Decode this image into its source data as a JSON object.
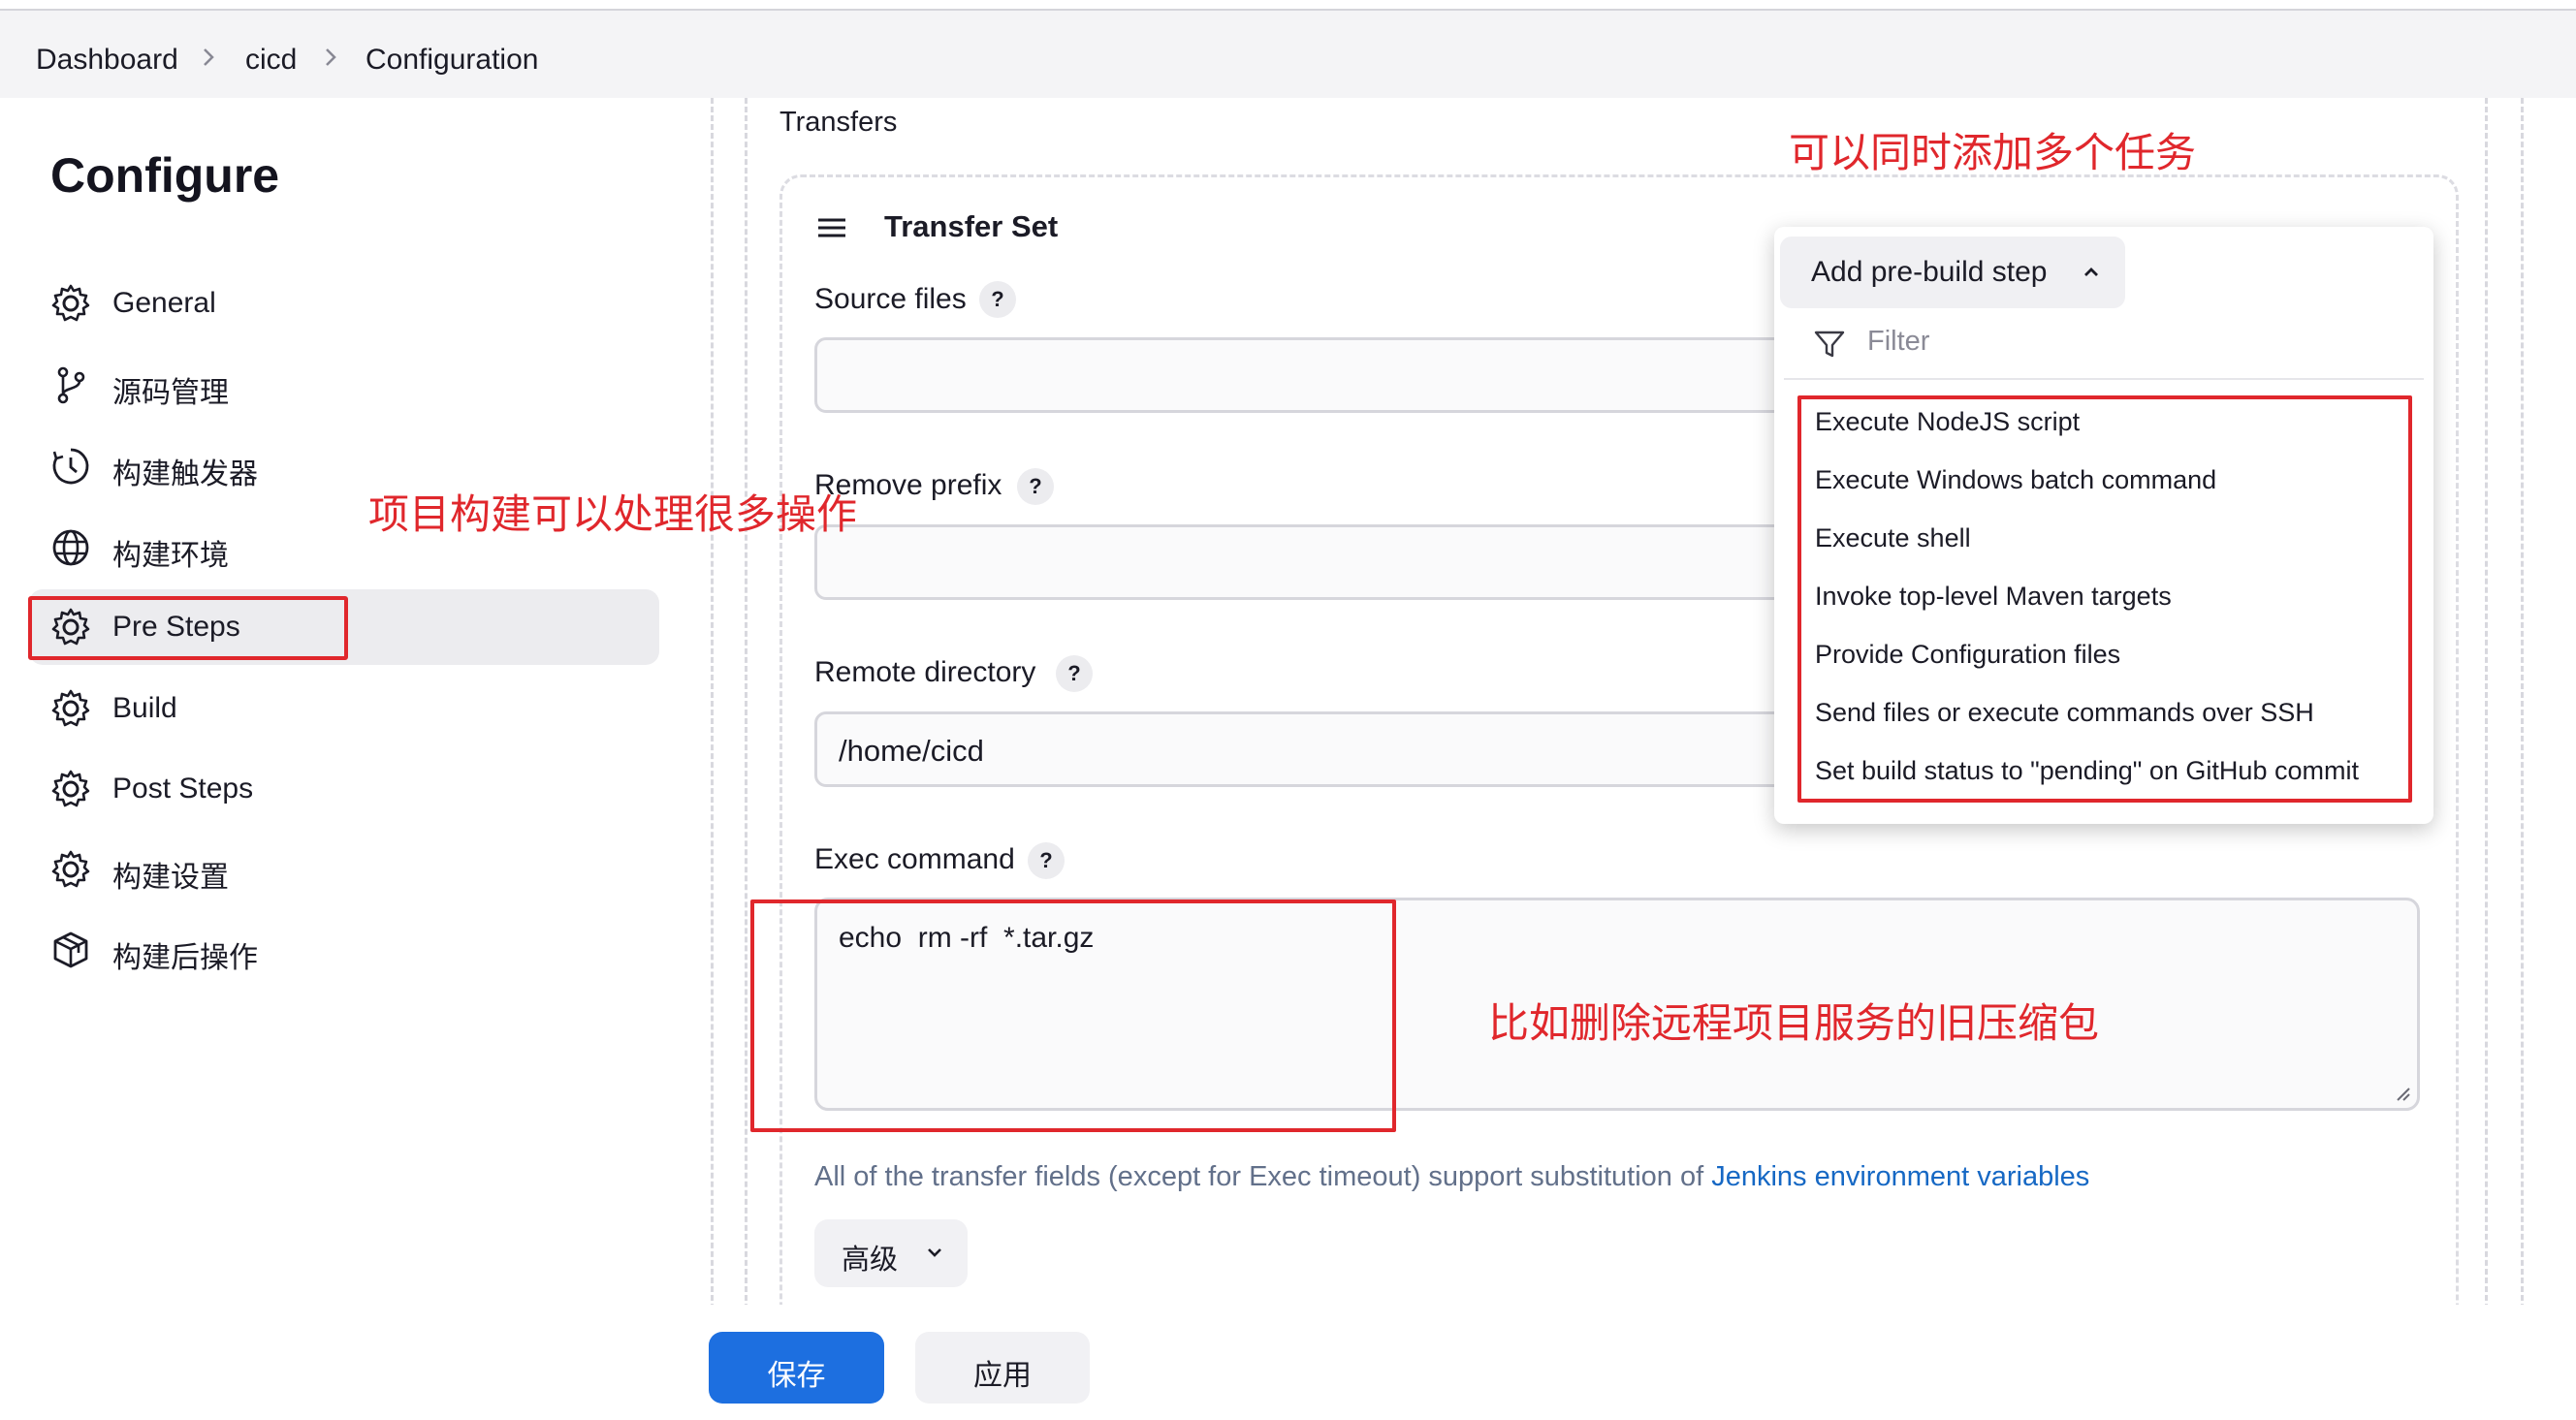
{
  "breadcrumb": [
    "Dashboard",
    "cicd",
    "Configuration"
  ],
  "page_title": "Configure",
  "sidebar": {
    "items": [
      {
        "label": "General",
        "icon": "gear-icon"
      },
      {
        "label": "源码管理",
        "icon": "branch-icon"
      },
      {
        "label": "构建触发器",
        "icon": "clock-icon"
      },
      {
        "label": "构建环境",
        "icon": "globe-icon"
      },
      {
        "label": "Pre Steps",
        "icon": "gear-icon",
        "active": true
      },
      {
        "label": "Build",
        "icon": "gear-icon"
      },
      {
        "label": "Post Steps",
        "icon": "gear-icon"
      },
      {
        "label": "构建设置",
        "icon": "gear-icon"
      },
      {
        "label": "构建后操作",
        "icon": "package-icon"
      }
    ]
  },
  "main": {
    "transfers_label": "Transfers",
    "transfer_set_title": "Transfer Set",
    "help_glyph": "?",
    "fields": {
      "source_files": {
        "label": "Source files",
        "value": ""
      },
      "remove_prefix": {
        "label": "Remove prefix",
        "value": ""
      },
      "remote_directory": {
        "label": "Remote directory",
        "value": "/home/cicd"
      },
      "exec_command": {
        "label": "Exec command",
        "value": "echo  rm -rf  *.tar.gz"
      }
    },
    "hint_text": "All of the transfer fields (except for Exec timeout) support substitution of ",
    "hint_link": "Jenkins environment variables",
    "advanced_label": "高级"
  },
  "dropdown": {
    "trigger_label": "Add pre-build step",
    "filter_placeholder": "Filter",
    "items": [
      "Execute NodeJS script",
      "Execute Windows batch command",
      "Execute shell",
      "Invoke top-level Maven targets",
      "Provide Configuration files",
      "Send files or execute commands over SSH",
      "Set build status to \"pending\" on GitHub commit"
    ]
  },
  "annotations": {
    "multi_task": "可以同时添加多个任务",
    "many_operations": "项目构建可以处理很多操作",
    "delete_example": "比如删除远程项目服务的旧压缩包"
  },
  "footer": {
    "save_label": "保存",
    "apply_label": "应用"
  },
  "colors": {
    "accent": "#1d6fe0",
    "annotation_red": "#e0272c",
    "link": "#1668c4"
  }
}
